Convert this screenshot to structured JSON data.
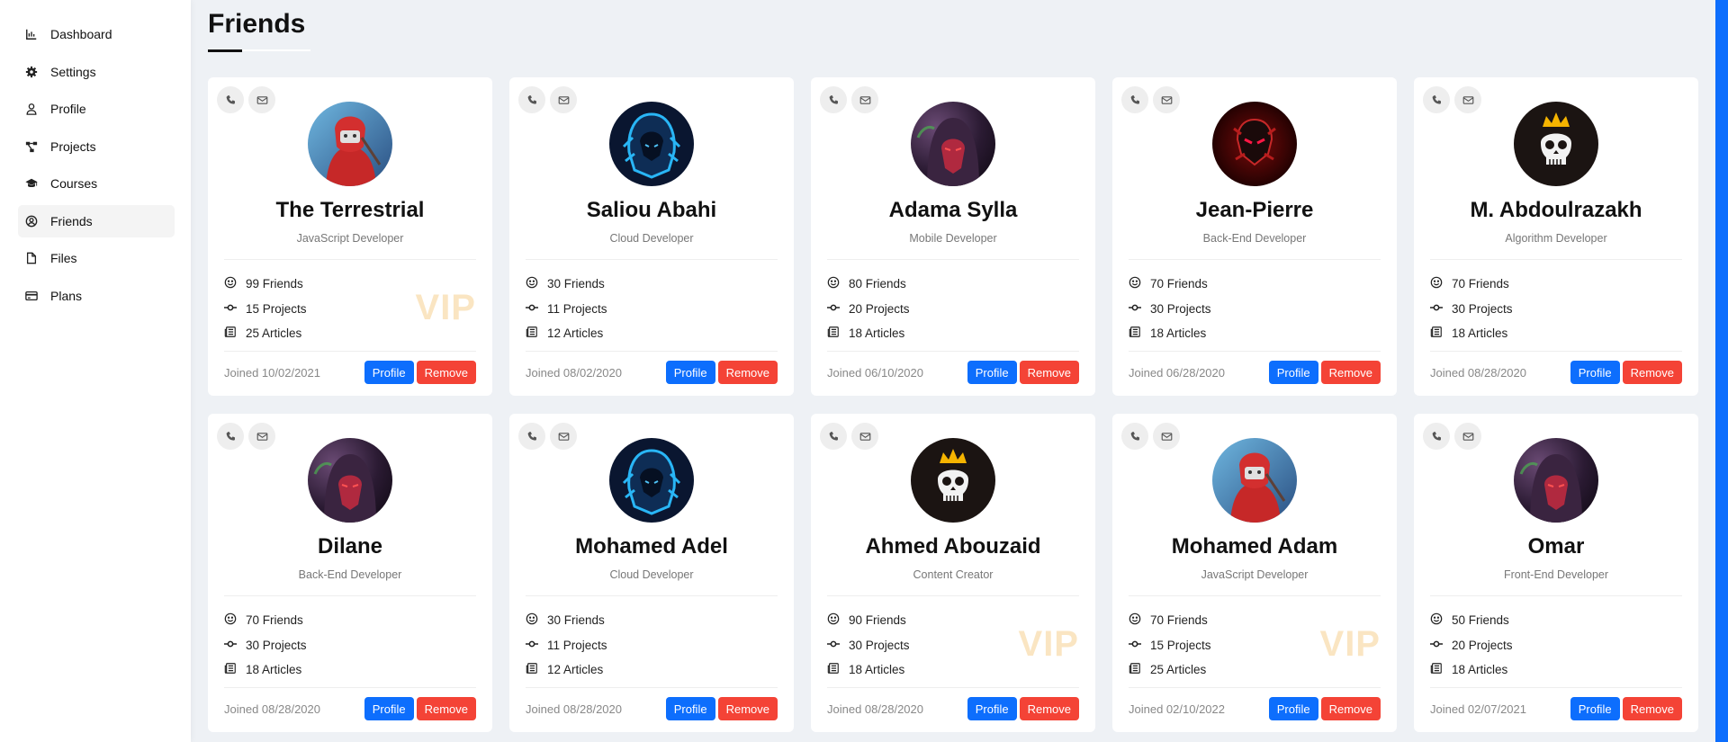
{
  "sidebar": {
    "items": [
      {
        "label": "Dashboard",
        "icon": "chart-line-icon"
      },
      {
        "label": "Settings",
        "icon": "gear-icon"
      },
      {
        "label": "Profile",
        "icon": "user-icon"
      },
      {
        "label": "Projects",
        "icon": "diagram-project-icon"
      },
      {
        "label": "Courses",
        "icon": "graduation-cap-icon"
      },
      {
        "label": "Friends",
        "icon": "circle-user-icon",
        "active": true
      },
      {
        "label": "Files",
        "icon": "file-icon"
      },
      {
        "label": "Plans",
        "icon": "credit-card-icon"
      }
    ]
  },
  "page": {
    "title": "Friends"
  },
  "colors": {
    "accent": "#0d6efd",
    "remove": "#f44336",
    "vip": "#f9dfb3"
  },
  "labels": {
    "profile_button": "Profile",
    "remove_button": "Remove"
  },
  "friends": [
    {
      "name": "The Terrestrial",
      "role": "JavaScript Developer",
      "friends": "99 Friends",
      "projects": "15 Projects",
      "articles": "25 Articles",
      "joined": "Joined 10/02/2021",
      "vip": "VIP",
      "avatar": "red-hooded-ninja"
    },
    {
      "name": "Saliou Abahi",
      "role": "Cloud Developer",
      "friends": "30 Friends",
      "projects": "11 Projects",
      "articles": "12 Articles",
      "joined": "Joined 08/02/2020",
      "vip": "",
      "avatar": "blue-hooded-emblem"
    },
    {
      "name": "Adama Sylla",
      "role": "Mobile Developer",
      "friends": "80 Friends",
      "projects": "20 Projects",
      "articles": "18 Articles",
      "joined": "Joined 06/10/2020",
      "vip": "",
      "avatar": "dark-hooded-figure"
    },
    {
      "name": "Jean-Pierre",
      "role": "Back-End Developer",
      "friends": "70 Friends",
      "projects": "30 Projects",
      "articles": "18 Articles",
      "joined": "Joined 06/28/2020",
      "vip": "",
      "avatar": "red-demon-emblem"
    },
    {
      "name": "M. Abdoulrazakh",
      "role": "Algorithm Developer",
      "friends": "70 Friends",
      "projects": "30 Projects",
      "articles": "18 Articles",
      "joined": "Joined 08/28/2020",
      "vip": "",
      "avatar": "crowned-skull"
    },
    {
      "name": "Dilane",
      "role": "Back-End Developer",
      "friends": "70 Friends",
      "projects": "30 Projects",
      "articles": "18 Articles",
      "joined": "Joined 08/28/2020",
      "vip": "",
      "avatar": "dark-hooded-figure"
    },
    {
      "name": "Mohamed Adel",
      "role": "Cloud Developer",
      "friends": "30 Friends",
      "projects": "11 Projects",
      "articles": "12 Articles",
      "joined": "Joined 08/28/2020",
      "vip": "",
      "avatar": "blue-hooded-emblem"
    },
    {
      "name": "Ahmed Abouzaid",
      "role": "Content Creator",
      "friends": "90 Friends",
      "projects": "30 Projects",
      "articles": "18 Articles",
      "joined": "Joined 08/28/2020",
      "vip": "VIP",
      "avatar": "crowned-skull"
    },
    {
      "name": "Mohamed Adam",
      "role": "JavaScript Developer",
      "friends": "70 Friends",
      "projects": "15 Projects",
      "articles": "25 Articles",
      "joined": "Joined 02/10/2022",
      "vip": "VIP",
      "avatar": "red-hooded-ninja"
    },
    {
      "name": "Omar",
      "role": "Front-End Developer",
      "friends": "50 Friends",
      "projects": "20 Projects",
      "articles": "18 Articles",
      "joined": "Joined 02/07/2021",
      "vip": "",
      "avatar": "dark-hooded-figure"
    }
  ]
}
